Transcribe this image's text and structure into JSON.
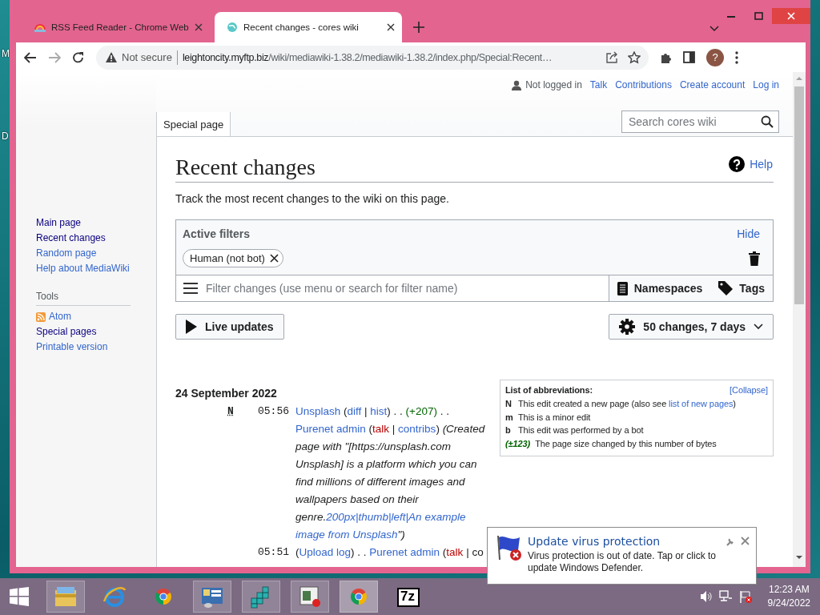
{
  "desktop": {
    "labels": [
      "M",
      "D"
    ]
  },
  "browser": {
    "tabs": [
      {
        "title": "RSS Feed Reader - Chrome Web",
        "selected": false
      },
      {
        "title": "Recent changes - cores wiki",
        "selected": true
      }
    ],
    "security": "Not secure",
    "url_host": "leightoncity.myftp.biz",
    "url_path": "/wiki/mediawiki-1.38.2/mediawiki-1.38.2/index.php/Special:Recent…",
    "profile": "?"
  },
  "personal_tools": {
    "status": "Not logged in",
    "links": [
      "Talk",
      "Contributions",
      "Create account",
      "Log in"
    ]
  },
  "sidebar": {
    "navigation": [
      {
        "label": "Main page",
        "visited": true
      },
      {
        "label": "Recent changes",
        "visited": true
      },
      {
        "label": "Random page",
        "visited": false
      },
      {
        "label": "Help about MediaWiki",
        "visited": false
      }
    ],
    "tools_heading": "Tools",
    "tools": [
      {
        "label": "Atom",
        "kind": "feed",
        "visited": false
      },
      {
        "label": "Special pages",
        "kind": "link",
        "visited": true
      },
      {
        "label": "Printable version",
        "kind": "link",
        "visited": false
      }
    ]
  },
  "page_tabs": [
    {
      "label": "Special page",
      "selected": true
    }
  ],
  "search": {
    "placeholder": "Search cores wiki"
  },
  "page": {
    "title": "Recent changes",
    "help": "Help",
    "intro": "Track the most recent changes to the wiki on this page."
  },
  "filters": {
    "heading": "Active filters",
    "hide": "Hide",
    "tags": [
      {
        "label": "Human (not bot)"
      }
    ],
    "placeholder": "Filter changes (use menu or search for filter name)",
    "namespaces": "Namespaces",
    "tags_button": "Tags",
    "live_updates": "Live updates",
    "period": "50 changes, 7 days"
  },
  "changes": {
    "date": "24 September 2022",
    "entries": [
      {
        "flag": "N",
        "time": "05:56",
        "segments": [
          {
            "kind": "link",
            "text": "Unsplash"
          },
          {
            "kind": "text",
            "text": " ("
          },
          {
            "kind": "link",
            "text": "diff"
          },
          {
            "kind": "text",
            "text": " | "
          },
          {
            "kind": "link",
            "text": "hist"
          },
          {
            "kind": "text",
            "text": ") . . "
          },
          {
            "kind": "size",
            "text": "(+207)"
          },
          {
            "kind": "text",
            "text": " . . "
          },
          {
            "kind": "link",
            "text": "Purenet admin"
          },
          {
            "kind": "text",
            "text": " ("
          },
          {
            "kind": "new",
            "text": "talk"
          },
          {
            "kind": "text",
            "text": " | "
          },
          {
            "kind": "link",
            "text": "contribs"
          },
          {
            "kind": "text",
            "text": ") "
          },
          {
            "kind": "italic",
            "text": "(Created page with \"[https://unsplash.com Unsplash] is a platform which you can find millions of different images and wallpapers based on their genre."
          },
          {
            "kind": "italic-link",
            "text": "200px|thumb|left|An example image from Unsplash"
          },
          {
            "kind": "italic",
            "text": "\")"
          }
        ]
      },
      {
        "time": "05:51",
        "segments": [
          {
            "kind": "text",
            "text": "("
          },
          {
            "kind": "link",
            "text": "Upload log"
          },
          {
            "kind": "text",
            "text": ") . . "
          },
          {
            "kind": "link",
            "text": "Purenet admin"
          },
          {
            "kind": "text",
            "text": " ("
          },
          {
            "kind": "new",
            "text": "talk"
          },
          {
            "kind": "text",
            "text": " | co"
          }
        ]
      }
    ]
  },
  "abbreviations": {
    "heading": "List of abbreviations:",
    "collapse": "[Collapse]",
    "items": [
      {
        "key": "N",
        "kind": "letter",
        "segments": [
          {
            "kind": "text",
            "text": "This edit created a new page (also see "
          },
          {
            "kind": "link",
            "text": "list of new pages"
          },
          {
            "kind": "text",
            "text": ")"
          }
        ]
      },
      {
        "key": "m",
        "kind": "letter",
        "segments": [
          {
            "kind": "text",
            "text": "This is a minor edit"
          }
        ]
      },
      {
        "key": "b",
        "kind": "letter",
        "segments": [
          {
            "kind": "text",
            "text": "This edit was performed by a bot"
          }
        ]
      },
      {
        "key": "(±123)",
        "kind": "size",
        "segments": [
          {
            "kind": "text",
            "text": "The page size changed by this number of bytes"
          }
        ]
      }
    ]
  },
  "notification": {
    "title": "Update virus protection",
    "body": "Virus protection is out of date. Tap or click to update Windows Defender."
  },
  "taskbar": {
    "apps": [
      {
        "kind": "explorer",
        "running": true,
        "selected": false
      },
      {
        "kind": "ie",
        "running": false,
        "selected": false
      },
      {
        "kind": "chrome",
        "running": false,
        "selected": false
      },
      {
        "kind": "control-panel",
        "running": true,
        "selected": false
      },
      {
        "kind": "registry",
        "running": true,
        "selected": false
      },
      {
        "kind": "app-window",
        "running": true,
        "selected": false
      },
      {
        "kind": "chrome",
        "running": true,
        "selected": true
      },
      {
        "kind": "archiver",
        "running": false,
        "selected": false,
        "label": "7z"
      }
    ],
    "clock": {
      "time": "12:23 AM",
      "date": "9/24/2022"
    }
  }
}
